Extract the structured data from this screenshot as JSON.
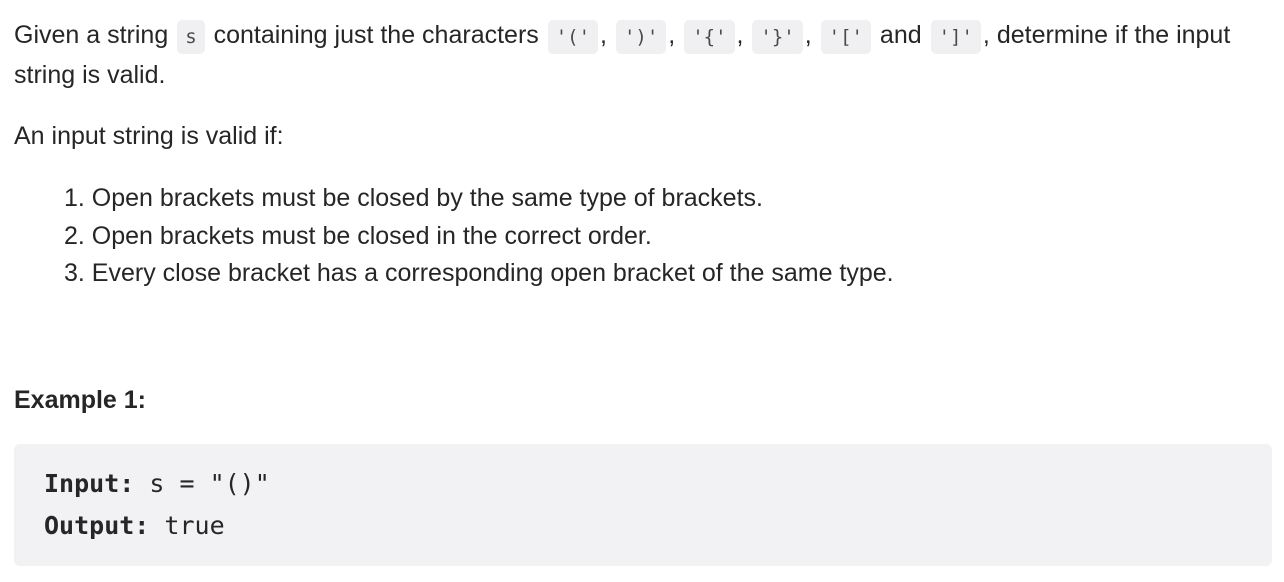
{
  "intro": {
    "t1": "Given a string ",
    "var_s": "s",
    "t2": " containing just the characters ",
    "c1": "'('",
    "sep1": ", ",
    "c2": "')'",
    "sep2": ", ",
    "c3": "'{'",
    "sep3": ", ",
    "c4": "'}'",
    "sep4": ", ",
    "c5": "'['",
    "and": " and ",
    "c6": "']'",
    "t3": ", determine if the input string is valid."
  },
  "valid_if": "An input string is valid if:",
  "rules": [
    "1. Open brackets must be closed by the same type of brackets.",
    "2. Open brackets must be closed in the correct order.",
    "3. Every close bracket has a corresponding open bracket of the same type."
  ],
  "example": {
    "heading": "Example 1:",
    "input_label": "Input:",
    "input_value": " s = \"()\"",
    "output_label": "Output:",
    "output_value": " true"
  }
}
